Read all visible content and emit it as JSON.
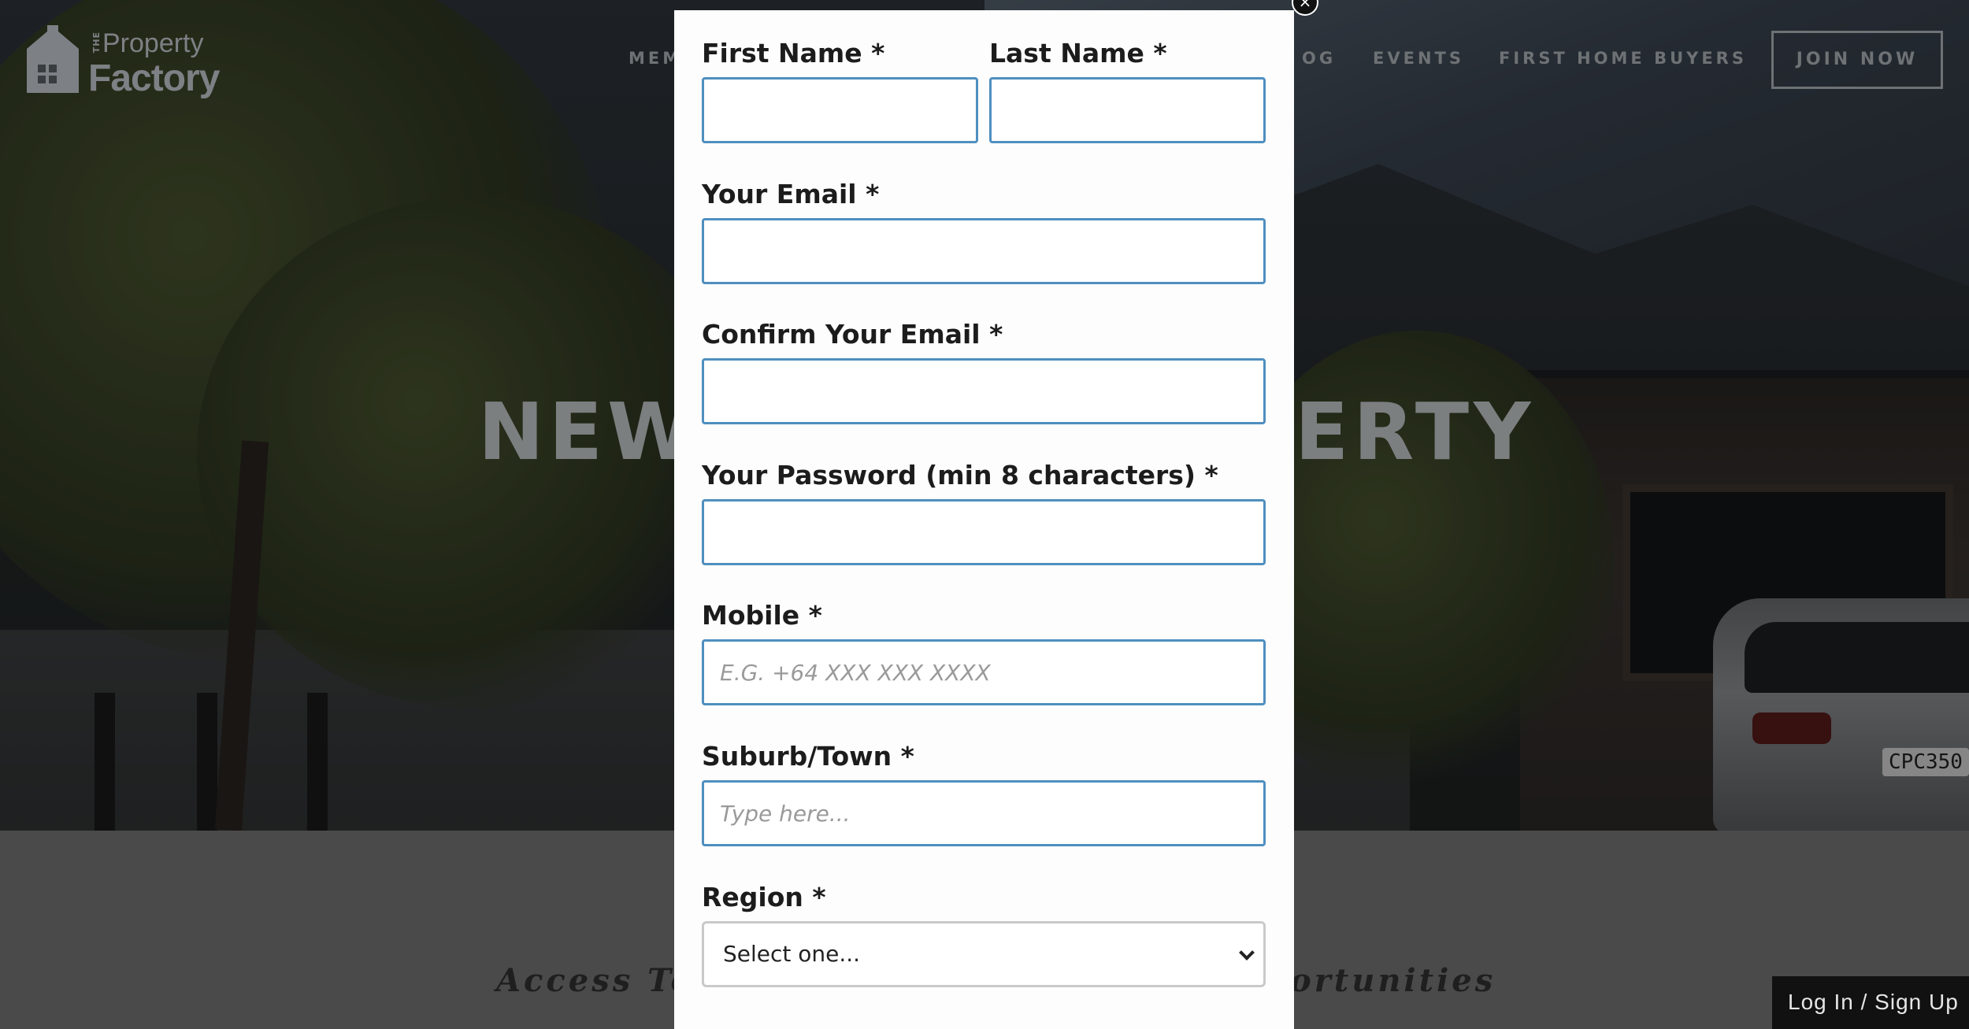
{
  "header": {
    "logo": {
      "the": "THE",
      "property": "Property",
      "factory": "Factory"
    },
    "nav": {
      "members_partial": "MEM",
      "blog_partial": "OG",
      "events": "EVENTS",
      "first_home_buyers": "FIRST HOME BUYERS"
    },
    "join_label": "JOIN NOW"
  },
  "hero": {
    "title_left": "NEW",
    "title_right": "ERTY",
    "car_plate": "CPC350"
  },
  "lower": {
    "tagline_left": "Access To",
    "tagline_right": "ortunities",
    "login_label": "Log In / Sign Up"
  },
  "modal": {
    "close_symbol": "×",
    "first_name": {
      "label": "First Name *",
      "value": ""
    },
    "last_name": {
      "label": "Last Name *",
      "value": ""
    },
    "email": {
      "label": "Your Email *",
      "value": ""
    },
    "confirm_email": {
      "label": "Confirm Your Email *",
      "value": ""
    },
    "password": {
      "label": "Your Password (min 8 characters) *",
      "value": ""
    },
    "mobile": {
      "label": "Mobile *",
      "placeholder": "E.G. +64 XXX XXX XXXX"
    },
    "suburb": {
      "label": "Suburb/Town *",
      "placeholder": "Type here..."
    },
    "region": {
      "label": "Region *",
      "selected": "Select one..."
    }
  },
  "colors": {
    "input_border": "#4f8fbf",
    "modal_bg": "#fdfdfd",
    "login_bar_bg": "#111111"
  }
}
